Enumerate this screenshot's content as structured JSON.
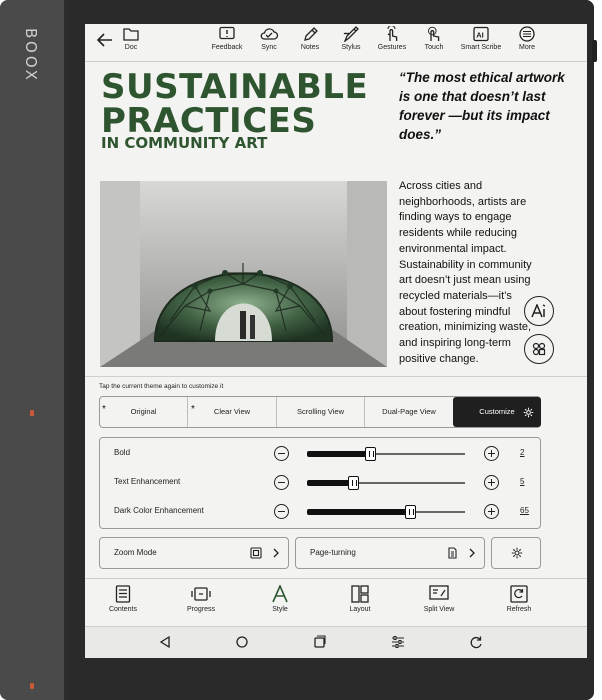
{
  "device": {
    "brand": "BOOX"
  },
  "toolbar": {
    "back_icon": "arrow-left-icon",
    "items": [
      {
        "label": "Doc",
        "icon": "folder-icon"
      },
      {
        "label": "Feedback",
        "icon": "feedback-icon"
      },
      {
        "label": "Sync",
        "icon": "cloud-sync-icon"
      },
      {
        "label": "Notes",
        "icon": "pencil-icon"
      },
      {
        "label": "Stylus",
        "icon": "stylus-icon"
      },
      {
        "label": "Gestures",
        "icon": "hand-gesture-icon"
      },
      {
        "label": "Touch",
        "icon": "touch-icon"
      },
      {
        "label": "Smart Scribe",
        "icon": "ai-icon"
      },
      {
        "label": "More",
        "icon": "more-icon"
      }
    ]
  },
  "article": {
    "title_line1": "SUSTAINABLE",
    "title_line2": "PRACTICES",
    "subtitle": "IN COMMUNITY ART",
    "quote": "“The most ethical artwork is one that doesn’t last forever —but its impact does.”",
    "body": "Across cities and neighborhoods, artists are finding ways to engage residents while reducing environmental impact. Sustainability in community art doesn’t just mean using recycled materials—it’s about fostering mindful creation, minimizing waste, and inspiring long-term positive change.",
    "title_color": "#2f5530"
  },
  "floating": {
    "ai_button_icon": "ai-icon",
    "apps_button_icon": "apps-icon"
  },
  "theme_panel": {
    "hint": "Tap the current theme again to customize it",
    "tabs": [
      {
        "label": "Original",
        "starred": true
      },
      {
        "label": "Clear View",
        "starred": true
      },
      {
        "label": "Scrolling View",
        "starred": false
      },
      {
        "label": "Dual-Page View",
        "starred": false
      },
      {
        "label": "Customize",
        "starred": false,
        "active": true
      }
    ],
    "star": "*",
    "sliders": [
      {
        "label": "Bold",
        "value": "2",
        "fraction": 0.4
      },
      {
        "label": "Text Enhancement",
        "value": "5",
        "fraction": 0.29
      },
      {
        "label": "Dark Color Enhancement",
        "value": "65",
        "fraction": 0.65
      }
    ],
    "zoom_mode": "Zoom Mode",
    "page_turning": "Page-turning"
  },
  "bottom_nav": [
    {
      "label": "Contents",
      "icon": "contents-icon"
    },
    {
      "label": "Progress",
      "icon": "progress-icon"
    },
    {
      "label": "Style",
      "icon": "style-icon"
    },
    {
      "label": "Layout",
      "icon": "layout-icon"
    },
    {
      "label": "Split View",
      "icon": "split-view-icon"
    },
    {
      "label": "Refresh",
      "icon": "refresh-icon"
    }
  ],
  "system_nav": [
    "back-triangle-icon",
    "home-circle-icon",
    "recents-icon",
    "settings-sliders-icon",
    "refresh-arrow-icon"
  ]
}
